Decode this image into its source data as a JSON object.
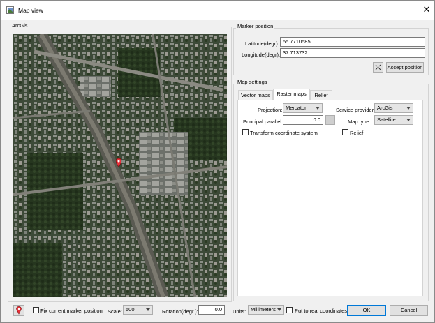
{
  "window": {
    "title": "Map view",
    "close_label": "✕"
  },
  "map_panel": {
    "title": "ArcGis"
  },
  "marker_position": {
    "title": "Marker position",
    "latitude_label": "Latitude(degr):",
    "latitude_value": "55.7710585",
    "longitude_label": "Longitude(degr):",
    "longitude_value": "37.713732",
    "accept_label": "Accept position"
  },
  "map_settings": {
    "title": "Map settings",
    "tabs": [
      {
        "label": "Vector maps",
        "active": false
      },
      {
        "label": "Raster maps",
        "active": true
      },
      {
        "label": "Relief",
        "active": false
      }
    ],
    "projection_label": "Projection:",
    "projection_value": "Mercator",
    "service_provider_label": "Service provider:",
    "service_provider_value": "ArcGis",
    "principal_parallel_label": "Principal parallel:",
    "principal_parallel_value": "0.0",
    "map_type_label": "Map type:",
    "map_type_value": "Satellite",
    "transform_label": "Transform coordinate system",
    "relief_label": "Relief"
  },
  "bottom_bar": {
    "fix_marker_label": "Fix current marker position",
    "scale_label": "Scale:",
    "scale_value": "500",
    "rotation_label": "Rotation(degr.):",
    "rotation_value": "0.0",
    "units_label": "Units:",
    "units_value": "Millimeters",
    "real_coords_label": "Put to real coordinates",
    "ok_label": "OK",
    "cancel_label": "Cancel"
  },
  "colors": {
    "accent": "#0078d7",
    "marker": "#e8303a"
  }
}
